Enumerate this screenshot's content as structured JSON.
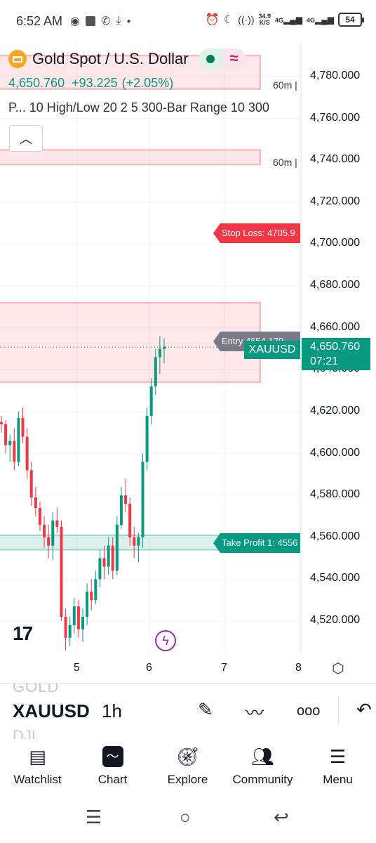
{
  "status_bar": {
    "time": "6:52 AM",
    "left_icons": [
      "eye-icon",
      "square-icon",
      "whatsapp-icon",
      "download-icon",
      "dot-icon"
    ],
    "net_speed_value": "34.9",
    "net_speed_unit": "K/S",
    "network_1": "4G",
    "network_2": "4G",
    "battery": "54"
  },
  "symbol": {
    "title": "Gold Spot / U.S. Dollar",
    "last": "4,650.760",
    "change": "+93.225",
    "change_pct": "(+2.05%)",
    "indicator": "P... 10 High/Low 20 2 5 300-Bar Range 10 300",
    "collapse_glyph": "^"
  },
  "chart_labels": {
    "tf_top": "60m |",
    "tf_mid": "60m |",
    "stop_loss": "Stop Loss: 4705.9",
    "entry": "Entry 4654.179",
    "take_profit": "Take Profit 1: 4556",
    "symbol_tag": "XAUUSD",
    "last_price": "4,650.760",
    "countdown": "07:21"
  },
  "chart_data": {
    "type": "candlestick",
    "ylim": [
      4505,
      4792
    ],
    "y_ticks": [
      "4,780.000",
      "4,760.000",
      "4,740.000",
      "4,720.000",
      "4,700.000",
      "4,680.000",
      "4,660.000",
      "4,640.000",
      "4,620.000",
      "4,600.000",
      "4,580.000",
      "4,560.000",
      "4,540.000",
      "4,520.000"
    ],
    "x_ticks": [
      "5",
      "6",
      "7",
      "8"
    ],
    "levels": {
      "stop_loss": 4705.9,
      "entry": 4654.179,
      "take_profit": 4556,
      "last": 4650.76
    },
    "zones": [
      {
        "type": "supply",
        "from": 4774,
        "to": 4790
      },
      {
        "type": "supply",
        "from": 4738,
        "to": 4745
      },
      {
        "type": "supply",
        "from": 4634,
        "to": 4672
      },
      {
        "type": "demand",
        "from": 4554,
        "to": 4561
      }
    ],
    "candles": [
      [
        4615,
        4618,
        4610,
        4614
      ],
      [
        4614,
        4616,
        4600,
        4604
      ],
      [
        4604,
        4609,
        4596,
        4606
      ],
      [
        4606,
        4612,
        4592,
        4596
      ],
      [
        4596,
        4620,
        4594,
        4617
      ],
      [
        4617,
        4622,
        4605,
        4608
      ],
      [
        4608,
        4612,
        4588,
        4592
      ],
      [
        4592,
        4596,
        4575,
        4579
      ],
      [
        4579,
        4584,
        4570,
        4574
      ],
      [
        4574,
        4577,
        4563,
        4566
      ],
      [
        4566,
        4570,
        4555,
        4560
      ],
      [
        4560,
        4566,
        4550,
        4556
      ],
      [
        4556,
        4572,
        4549,
        4568
      ],
      [
        4568,
        4574,
        4562,
        4565
      ],
      [
        4565,
        4568,
        4520,
        4522
      ],
      [
        4522,
        4526,
        4506,
        4512
      ],
      [
        4512,
        4522,
        4508,
        4518
      ],
      [
        4518,
        4531,
        4514,
        4527
      ],
      [
        4527,
        4530,
        4512,
        4516
      ],
      [
        4516,
        4526,
        4510,
        4522
      ],
      [
        4522,
        4538,
        4518,
        4534
      ],
      [
        4534,
        4540,
        4525,
        4530
      ],
      [
        4530,
        4544,
        4528,
        4540
      ],
      [
        4540,
        4554,
        4536,
        4550
      ],
      [
        4550,
        4556,
        4540,
        4546
      ],
      [
        4546,
        4560,
        4542,
        4556
      ],
      [
        4556,
        4560,
        4540,
        4544
      ],
      [
        4544,
        4570,
        4542,
        4566
      ],
      [
        4566,
        4584,
        4564,
        4580
      ],
      [
        4580,
        4588,
        4572,
        4576
      ],
      [
        4576,
        4579,
        4556,
        4560
      ],
      [
        4560,
        4565,
        4550,
        4556
      ],
      [
        4556,
        4562,
        4548,
        4560
      ],
      [
        4560,
        4600,
        4555,
        4596
      ],
      [
        4596,
        4622,
        4592,
        4618
      ],
      [
        4618,
        4636,
        4614,
        4632
      ],
      [
        4632,
        4650,
        4628,
        4646
      ],
      [
        4646,
        4656,
        4638,
        4650
      ],
      [
        4650,
        4655,
        4643,
        4651
      ]
    ]
  },
  "toolbar": {
    "ghost_top": "GOLD",
    "symbol": "XAUUSD",
    "interval": "1h",
    "ghost_bottom": "DJI",
    "icons": [
      "pen-icon",
      "trend-icon",
      "more-icon",
      "undo-icon"
    ]
  },
  "nav": {
    "watchlist": "Watchlist",
    "chart": "Chart",
    "explore": "Explore",
    "community": "Community",
    "menu": "Menu"
  }
}
